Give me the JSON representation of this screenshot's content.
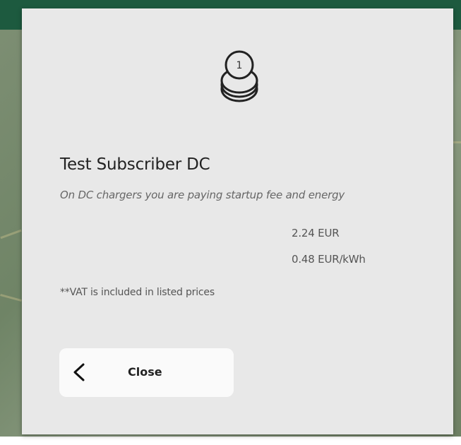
{
  "modal": {
    "icon": "coins-stack-icon",
    "icon_number": "1",
    "plan_name": "Test Subscriber DC",
    "plan_description": "On DC chargers you are paying startup fee and energy",
    "prices": [
      "2.24 EUR",
      "0.48 EUR/kWh"
    ],
    "vat_note": "**VAT is included in listed prices",
    "close_button": {
      "label": "Close",
      "icon": "chevron-left-icon"
    }
  },
  "colors": {
    "header_green": "#1d5a3f",
    "modal_background": "#e8e8e8",
    "button_background": "#fafafa"
  }
}
